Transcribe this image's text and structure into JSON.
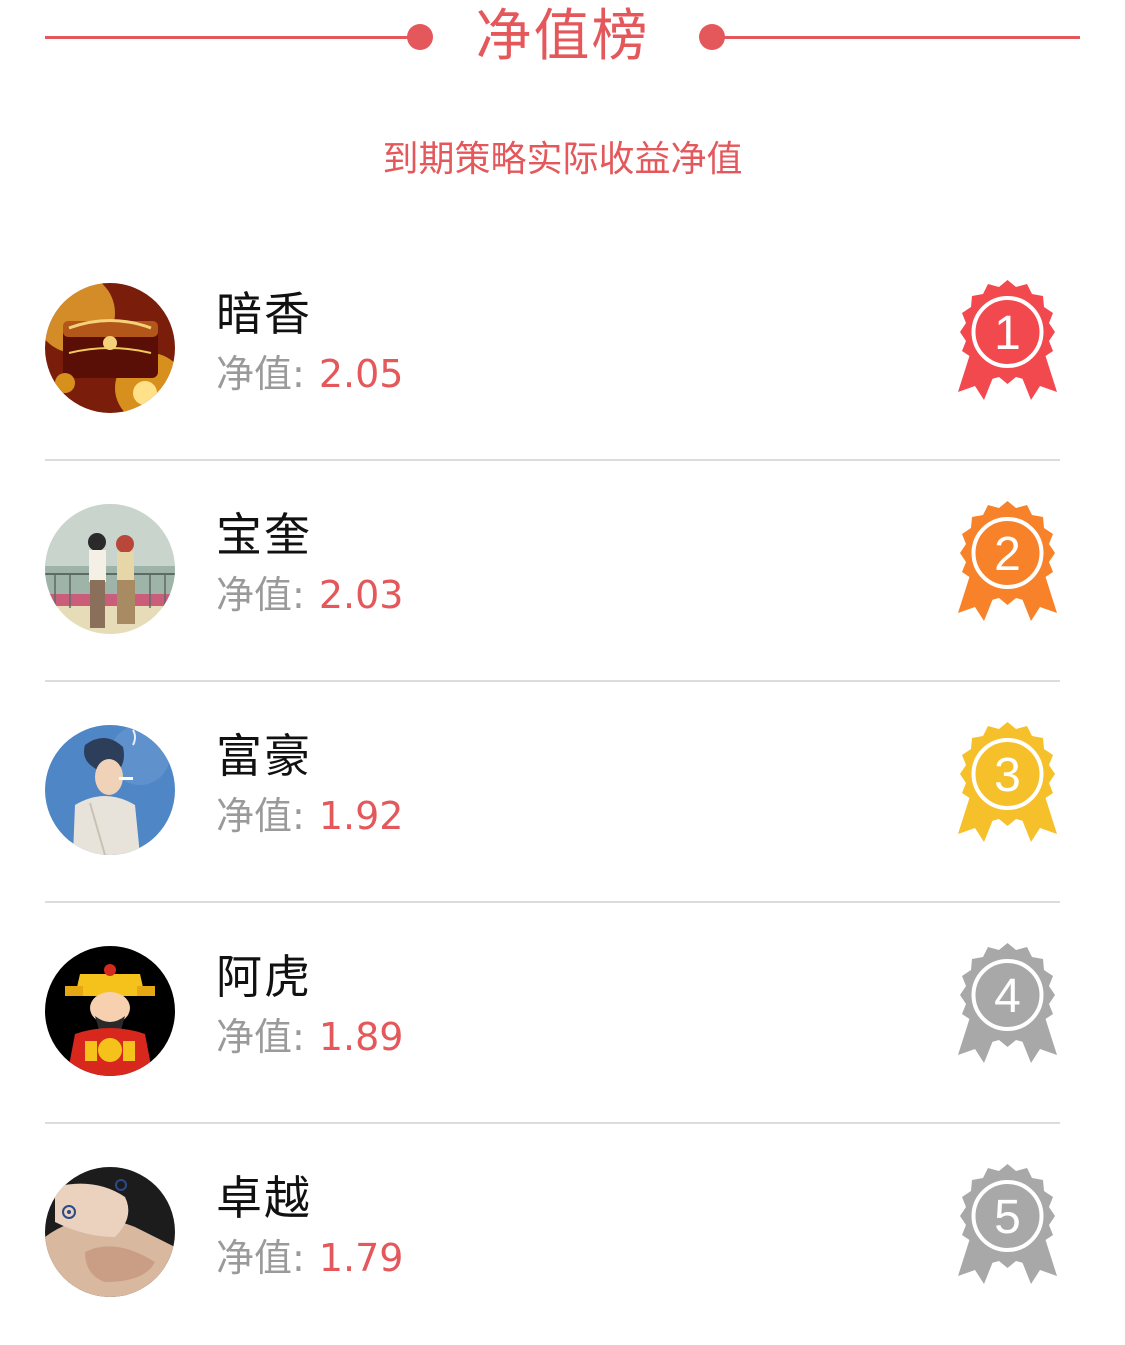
{
  "header": {
    "title": "净值榜",
    "subtitle": "到期策略实际收益净值",
    "accent_color": "#e4585b"
  },
  "ranking": [
    {
      "rank": "1",
      "name": "暗香",
      "nav_label": "净值:",
      "nav_value": "2.05",
      "medal_color": "#f2494f",
      "avatar": "treasure-box-avatar"
    },
    {
      "rank": "2",
      "name": "宝奎",
      "nav_label": "净值:",
      "nav_value": "2.03",
      "medal_color": "#f7822a",
      "avatar": "couple-balcony-avatar"
    },
    {
      "rank": "3",
      "name": "富豪",
      "nav_label": "净值:",
      "nav_value": "1.92",
      "medal_color": "#f5c02a",
      "avatar": "smoking-man-avatar"
    },
    {
      "rank": "4",
      "name": "阿虎",
      "nav_label": "净值:",
      "nav_value": "1.89",
      "medal_color": "#a8a8a8",
      "avatar": "fortune-god-avatar"
    },
    {
      "rank": "5",
      "name": "卓越",
      "nav_label": "净值:",
      "nav_value": "1.79",
      "medal_color": "#a8a8a8",
      "avatar": "holding-hands-avatar"
    }
  ]
}
